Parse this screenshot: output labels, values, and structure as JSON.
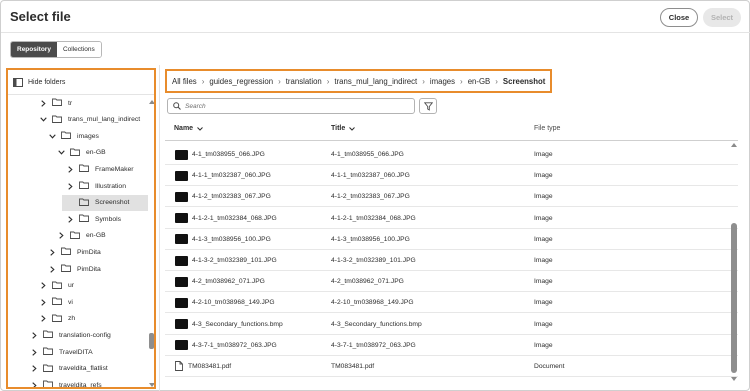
{
  "dialog": {
    "title": "Select file",
    "close_label": "Close",
    "select_label": "Select"
  },
  "tabs": {
    "repository": "Repository",
    "collections": "Collections"
  },
  "sidebar": {
    "hide_folders_label": "Hide folders",
    "tree": [
      {
        "label": "tr",
        "level": 2,
        "expanded": false
      },
      {
        "label": "trans_mul_lang_indirect",
        "level": 2,
        "expanded": true
      },
      {
        "label": "images",
        "level": 3,
        "expanded": true
      },
      {
        "label": "en-GB",
        "level": 4,
        "expanded": true
      },
      {
        "label": "FrameMaker",
        "level": 5,
        "expanded": false
      },
      {
        "label": "Illustration",
        "level": 5,
        "expanded": false
      },
      {
        "label": "Screenshot",
        "level": 5,
        "expanded": null,
        "selected": true
      },
      {
        "label": "Symbols",
        "level": 5,
        "expanded": false
      },
      {
        "label": "en-GB",
        "level": 4,
        "expanded": false
      },
      {
        "label": "PimDita",
        "level": 3,
        "expanded": false
      },
      {
        "label": "PimDita",
        "level": 3,
        "expanded": false
      },
      {
        "label": "ur",
        "level": 2,
        "expanded": false
      },
      {
        "label": "vi",
        "level": 2,
        "expanded": false
      },
      {
        "label": "zh",
        "level": 2,
        "expanded": false
      },
      {
        "label": "translation-config",
        "level": 1,
        "expanded": false
      },
      {
        "label": "TravelDITA",
        "level": 1,
        "expanded": false
      },
      {
        "label": "traveldita_flatlist",
        "level": 1,
        "expanded": false
      },
      {
        "label": "traveldita_refs",
        "level": 1,
        "expanded": false
      }
    ]
  },
  "breadcrumb": [
    "All files",
    "guides_regression",
    "translation",
    "trans_mul_lang_indirect",
    "images",
    "en-GB",
    "Screenshot"
  ],
  "search": {
    "placeholder": "Search"
  },
  "table": {
    "columns": [
      "Name",
      "Title",
      "File type"
    ],
    "rows": [
      {
        "name": "4-1_tm038955_066.JPG",
        "title": "4-1_tm038955_066.JPG",
        "type": "Image",
        "icon": "image-thumbnail"
      },
      {
        "name": "4-1-1_tm032387_060.JPG",
        "title": "4-1-1_tm032387_060.JPG",
        "type": "Image",
        "icon": "image-thumbnail"
      },
      {
        "name": "4-1-2_tm032383_067.JPG",
        "title": "4-1-2_tm032383_067.JPG",
        "type": "Image",
        "icon": "image-thumbnail"
      },
      {
        "name": "4-1-2-1_tm032384_068.JPG",
        "title": "4-1-2-1_tm032384_068.JPG",
        "type": "Image",
        "icon": "image-thumbnail"
      },
      {
        "name": "4-1-3_tm038956_100.JPG",
        "title": "4-1-3_tm038956_100.JPG",
        "type": "Image",
        "icon": "image-thumbnail"
      },
      {
        "name": "4-1-3-2_tm032389_101.JPG",
        "title": "4-1-3-2_tm032389_101.JPG",
        "type": "Image",
        "icon": "image-thumbnail"
      },
      {
        "name": "4-2_tm038962_071.JPG",
        "title": "4-2_tm038962_071.JPG",
        "type": "Image",
        "icon": "image-thumbnail"
      },
      {
        "name": "4-2-10_tm038968_149.JPG",
        "title": "4-2-10_tm038968_149.JPG",
        "type": "Image",
        "icon": "image-thumbnail"
      },
      {
        "name": "4-3_Secondary_functions.bmp",
        "title": "4-3_Secondary_functions.bmp",
        "type": "Image",
        "icon": "image-thumbnail"
      },
      {
        "name": "4-3-7-1_tm038972_063.JPG",
        "title": "4-3-7-1_tm038972_063.JPG",
        "type": "Image",
        "icon": "image-thumbnail"
      },
      {
        "name": "TM083481.pdf",
        "title": "TM083481.pdf",
        "type": "Document",
        "icon": "document-icon"
      }
    ]
  },
  "colors": {
    "highlight_border": "#e88c2c",
    "active_tab": "#4b4b4b",
    "selected_row": "#e1e1e1"
  }
}
